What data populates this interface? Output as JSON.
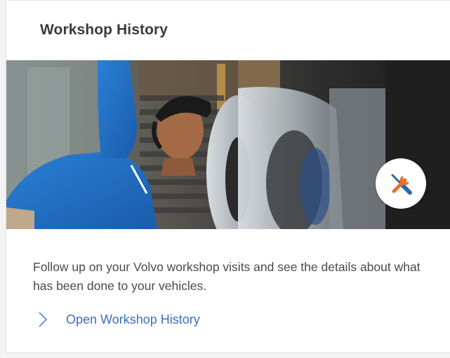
{
  "card": {
    "title": "Workshop History",
    "hero_image": {
      "badge_icon": "wrench-screwdriver-icon"
    },
    "description": "Follow up on your Volvo workshop visits and see the details about what has been done to your vehicles.",
    "link": {
      "icon": "chevron-right-icon",
      "label": "Open Workshop History"
    }
  },
  "colors": {
    "link": "#3c6fb8",
    "title": "#3a3a3a",
    "body_text": "#4a4a4a",
    "icon_orange": "#e8702a",
    "icon_blue": "#2d6aa8"
  }
}
